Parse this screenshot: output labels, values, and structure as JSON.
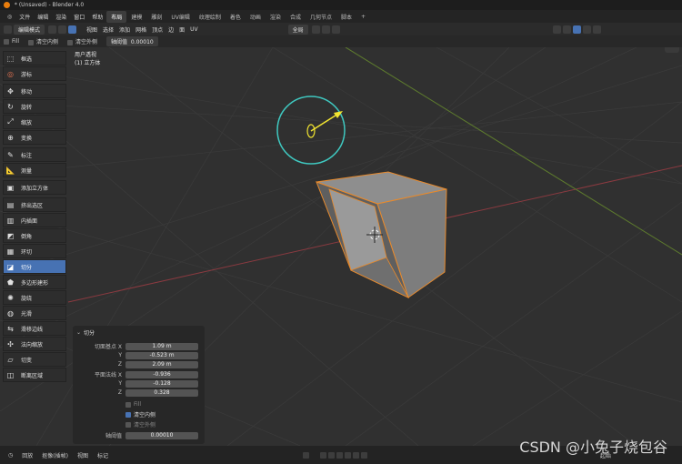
{
  "titlebar": {
    "title": "* (Unsaved) - Blender 4.0"
  },
  "menubar": {
    "menus": [
      "文件",
      "编辑",
      "渲染",
      "窗口",
      "帮助"
    ],
    "workspaces": [
      "布局",
      "建模",
      "雕刻",
      "UV编辑",
      "纹理绘制",
      "着色",
      "动画",
      "渲染",
      "合成",
      "几何节点",
      "脚本"
    ],
    "add_tab": "+"
  },
  "header": {
    "mode": "编辑模式",
    "menus": [
      "视图",
      "选择",
      "添加",
      "网格",
      "顶点",
      "边",
      "面",
      "UV"
    ],
    "transform": "全局"
  },
  "operator_bar": {
    "fill": "Fill",
    "clear_inner": "清空内侧",
    "clear_outer": "清空外侧",
    "threshold_label": "轴阈值",
    "threshold_value": "0.00010"
  },
  "overlay": {
    "line1": "用户透视",
    "line2": "(1) 立方体"
  },
  "tools": [
    "框选",
    "游标",
    "移动",
    "旋转",
    "缩放",
    "变换",
    "标注",
    "测量",
    "添加立方体",
    "挤出选区",
    "内插面",
    "倒角",
    "环切",
    "切分",
    "多边形建形",
    "旋绕",
    "光滑",
    "滑移边线",
    "法向缩放",
    "切变",
    "断离区域"
  ],
  "active_tool": "切分",
  "panel": {
    "title": "切分",
    "plane_point_label": "切面基点",
    "plane_normal_label": "平面法线",
    "axis_x": "X",
    "axis_y": "Y",
    "axis_z": "Z",
    "point": [
      "1.09 m",
      "-0.523 m",
      "2.09 m"
    ],
    "normal": [
      "-0.936",
      "-0.128",
      "0.328"
    ],
    "fill": "Fill",
    "clear_inner": "清空内侧",
    "clear_outer": "清空外侧",
    "threshold_label": "轴阈值",
    "threshold_value": "0.00010"
  },
  "timeline": {
    "items": [
      "回放",
      "抠像(插帧)",
      "视图",
      "标记"
    ],
    "right": "起始"
  },
  "watermark": "CSDN @小兔子烧包谷",
  "colors": {
    "accent": "#4772b3",
    "gizmo": "#3fc8c0",
    "arrow": "#f2e530",
    "edge_highlight": "#e88a2c"
  }
}
